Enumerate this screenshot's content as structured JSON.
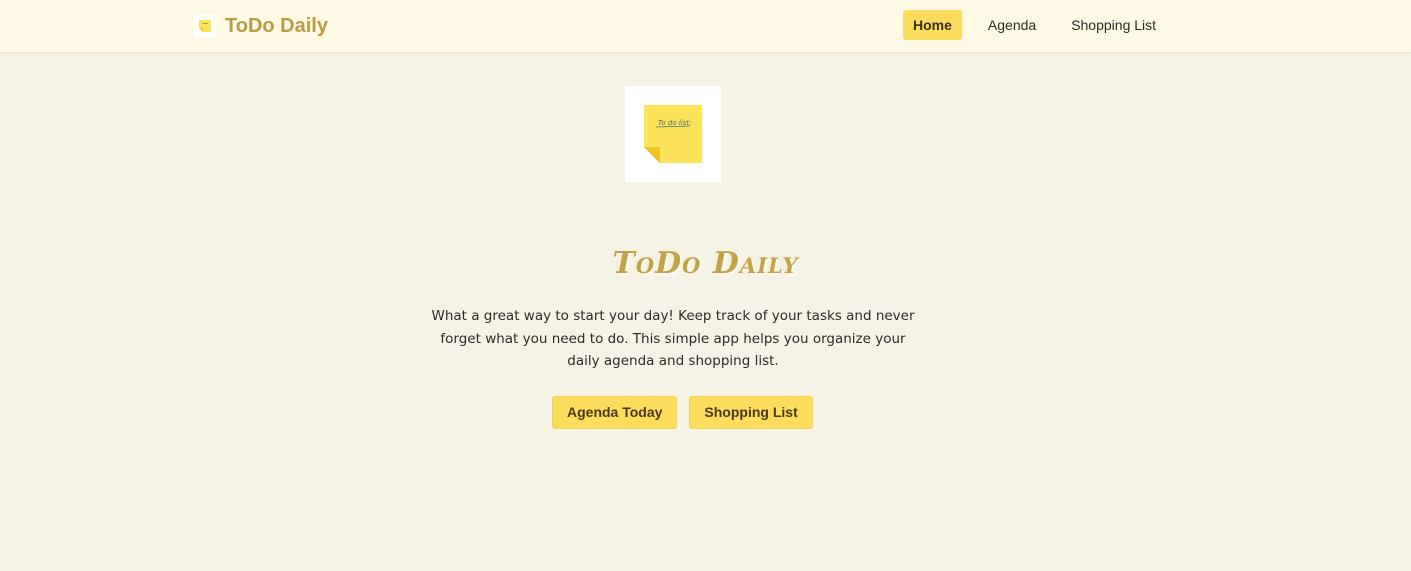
{
  "navbar": {
    "brand": {
      "title": "ToDo Daily",
      "logo_icon": "sticky-note-icon"
    },
    "links": [
      {
        "label": "Home",
        "active": true
      },
      {
        "label": "Agenda",
        "active": false
      },
      {
        "label": "Shopping List",
        "active": false
      }
    ]
  },
  "hero": {
    "image_icon": "sticky-note-todo-list-icon",
    "image_text": "To do list:",
    "title": "ToDo Daily",
    "description": "What a great way to start your day! Keep track of your tasks and never forget what you need to do. This simple app helps you organize your daily agenda and shopping list.",
    "buttons": [
      {
        "label": "Agenda Today"
      },
      {
        "label": "Shopping List"
      }
    ]
  },
  "colors": {
    "background": "#f5f2e6",
    "navbar_background": "#fef9e5",
    "accent": "#fcdc5c",
    "brand_text": "#b99b45"
  }
}
